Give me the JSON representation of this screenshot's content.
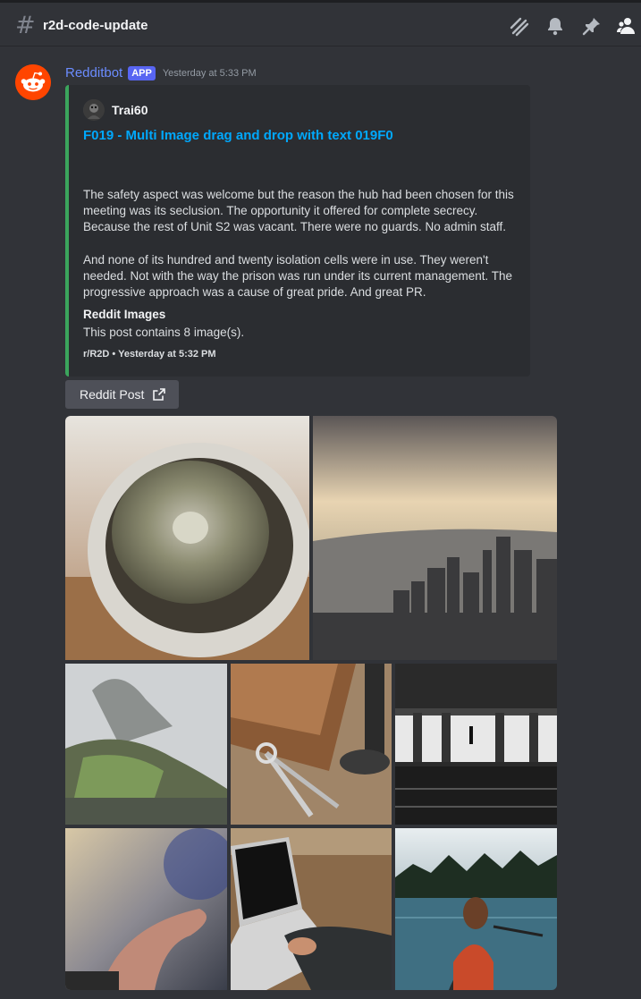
{
  "channel": {
    "name": "r2d-code-update"
  },
  "message": {
    "author": "Redditbot",
    "badge": "APP",
    "timestamp": "Yesterday at 5:33 PM"
  },
  "embed": {
    "author": "Trai60",
    "title": "F019 - Multi Image drag and drop with text 019F0",
    "paragraphs": [
      "The safety aspect was welcome but the reason the hub had been chosen for this meeting was its seclusion. The opportunity it offered for complete secrecy. Because the rest of Unit S2 was vacant. There were no guards. No admin staff.",
      "And none of its hundred and twenty isolation cells were in use. They weren't needed. Not with the way the prison was run under its current management. The progressive approach was a cause of great pride. And great PR."
    ],
    "field_name": "Reddit Images",
    "field_value": "This post contains 8 image(s).",
    "footer": "r/R2D • Yesterday at 5:32 PM",
    "accent_color": "#3ba55c"
  },
  "button": {
    "label": "Reddit Post"
  },
  "images": [
    {
      "name": "cactus-image"
    },
    {
      "name": "city-skyline-image"
    },
    {
      "name": "mountain-ruins-image"
    },
    {
      "name": "leather-desk-image"
    },
    {
      "name": "subway-station-image"
    },
    {
      "name": "hand-closeup-image"
    },
    {
      "name": "laptop-image"
    },
    {
      "name": "canoe-lake-image"
    }
  ]
}
